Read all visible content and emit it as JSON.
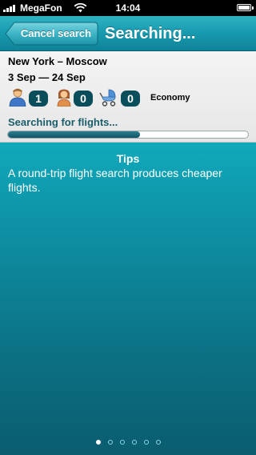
{
  "status_bar": {
    "carrier": "MegaFon",
    "time": "14:04",
    "icons": [
      "signal-icon",
      "wifi-icon",
      "battery-icon"
    ]
  },
  "nav": {
    "back_label": "Cancel search",
    "title": "Searching..."
  },
  "search": {
    "route": "New York – Moscow",
    "dates": "3 Sep — 24 Sep",
    "passengers": {
      "adults": "1",
      "children": "0",
      "infants": "0"
    },
    "cabin_class": "Economy"
  },
  "progress": {
    "label": "Searching for flights...",
    "value": 0.55
  },
  "tips": {
    "title": "Tips",
    "text": "A round-trip flight search produces cheaper flights."
  },
  "pager": {
    "total": 6,
    "active_index": 0
  },
  "colors": {
    "nav_accent": "#199cb0",
    "tips_background": "#0e8ea2",
    "count_badge": "#0b4e5b",
    "progress_fill": "#0f5565"
  }
}
